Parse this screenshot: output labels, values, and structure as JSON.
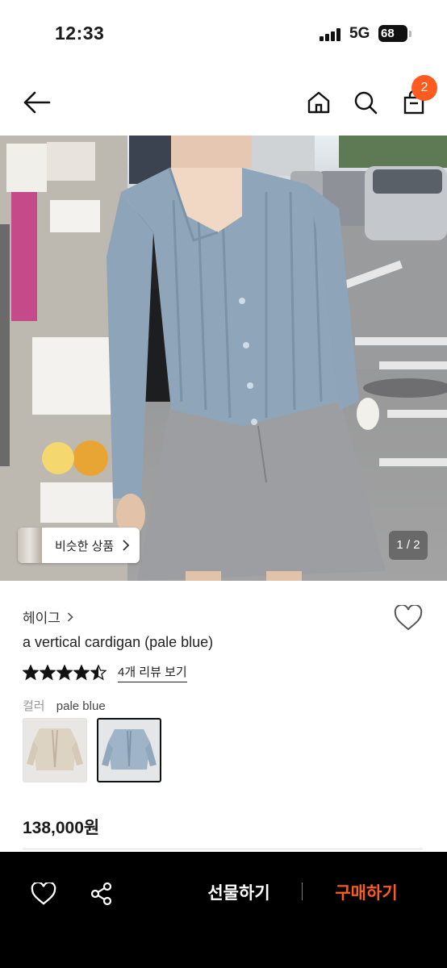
{
  "status_bar": {
    "time": "12:33",
    "network": "5G",
    "battery": "68"
  },
  "nav": {
    "back_icon": "arrow-left-icon",
    "home_icon": "home-icon",
    "search_icon": "search-icon",
    "bag_icon": "shopping-bag-icon",
    "cart_count": "2"
  },
  "gallery": {
    "similar_label": "비슷한 상품",
    "page_indicator": "1 / 2"
  },
  "product": {
    "brand": "헤이그",
    "title": "a vertical cardigan (pale blue)",
    "rating": 4.5,
    "rating_max": 5,
    "review_link": "4개 리뷰 보기",
    "option_key": "컬러",
    "option_value": "pale blue",
    "price": "138,000원"
  },
  "bottom_bar": {
    "gift_label": "선물하기",
    "buy_label": "구매하기"
  },
  "colors": {
    "accent": "#ff5a1f",
    "bar_background": "#000000"
  }
}
